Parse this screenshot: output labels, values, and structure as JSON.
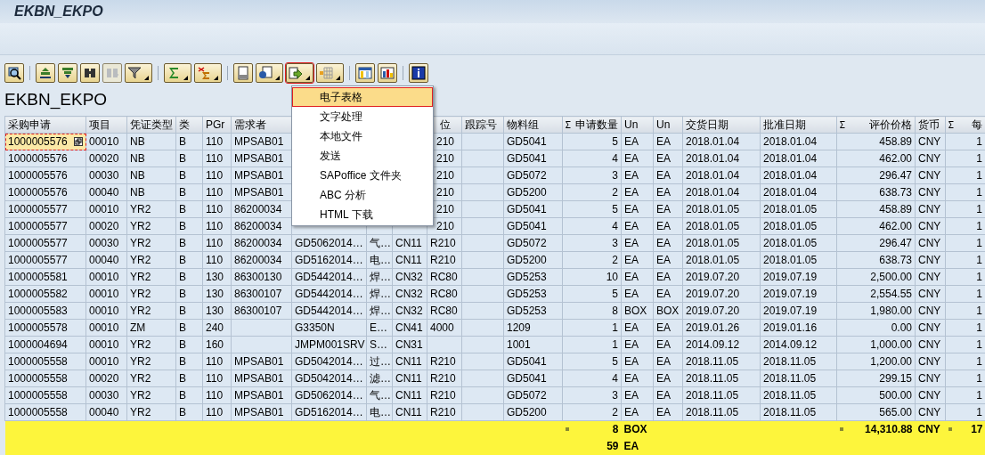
{
  "window": {
    "title": "EKBN_EKPO"
  },
  "toolbar": [
    {
      "dropdown": false,
      "disabled": false,
      "selected": false
    },
    {
      "dropdown": false,
      "disabled": false,
      "selected": false
    },
    {
      "dropdown": false,
      "disabled": false,
      "selected": false
    },
    {
      "dropdown": false,
      "disabled": false,
      "selected": false
    },
    {
      "dropdown": false,
      "disabled": true,
      "selected": false
    },
    {
      "dropdown": true,
      "disabled": false,
      "selected": false
    },
    {
      "dropdown": true,
      "disabled": false,
      "selected": false
    },
    {
      "dropdown": true,
      "disabled": false,
      "selected": false
    },
    {
      "dropdown": false,
      "disabled": false,
      "selected": false
    },
    {
      "dropdown": true,
      "disabled": false,
      "selected": false
    },
    {
      "dropdown": true,
      "disabled": false,
      "selected": true
    },
    {
      "dropdown": true,
      "disabled": false,
      "selected": false
    },
    {
      "dropdown": false,
      "disabled": false,
      "selected": false
    },
    {
      "dropdown": false,
      "disabled": false,
      "selected": false
    },
    {
      "dropdown": false,
      "disabled": false,
      "selected": false
    }
  ],
  "list_title": "EKBN_EKPO",
  "export_menu": [
    {
      "label": "电子表格",
      "selected": true
    },
    {
      "label": "文字处理",
      "selected": false
    },
    {
      "label": "本地文件",
      "selected": false
    },
    {
      "label": "发送",
      "selected": false
    },
    {
      "label": "SAPoffice 文件夹",
      "selected": false
    },
    {
      "label": "ABC 分析",
      "selected": false
    },
    {
      "label": "HTML 下载",
      "selected": false
    }
  ],
  "table": {
    "columns": [
      {
        "label": "采购申请",
        "sum": false
      },
      {
        "label": "项目",
        "sum": false
      },
      {
        "label": "凭证类型",
        "sum": false
      },
      {
        "label": "类",
        "sum": false
      },
      {
        "label": "PGr",
        "sum": false
      },
      {
        "label": "需求者",
        "sum": false
      },
      {},
      {},
      {},
      {
        "label": "位",
        "sum": false
      },
      {
        "label": "跟踪号",
        "sum": false
      },
      {
        "label": "物料组",
        "sum": false
      },
      {
        "label": "申请数量",
        "sum": true
      },
      {
        "label": "Un",
        "sum": false
      },
      {
        "label": "Un",
        "sum": false
      },
      {
        "label": "交货日期",
        "sum": false
      },
      {
        "label": "批准日期",
        "sum": false
      },
      {
        "label": "评价价格",
        "sum": true
      },
      {
        "label": "货币",
        "sum": false
      },
      {
        "label": "每",
        "sum": true
      }
    ],
    "rows": [
      {
        "focused": true,
        "cells": [
          "1000005576",
          "00010",
          "NB",
          "B",
          "110",
          "MPSAB01",
          null,
          null,
          null,
          "210",
          null,
          "GD5041",
          "5",
          "EA",
          "EA",
          "2018.01.04",
          "2018.01.04",
          "458.89",
          "CNY",
          "1"
        ]
      },
      {
        "focused": false,
        "cells": [
          "1000005576",
          "00020",
          "NB",
          "B",
          "110",
          "MPSAB01",
          null,
          null,
          null,
          "210",
          null,
          "GD5041",
          "4",
          "EA",
          "EA",
          "2018.01.04",
          "2018.01.04",
          "462.00",
          "CNY",
          "1"
        ]
      },
      {
        "focused": false,
        "cells": [
          "1000005576",
          "00030",
          "NB",
          "B",
          "110",
          "MPSAB01",
          null,
          null,
          null,
          "210",
          null,
          "GD5072",
          "3",
          "EA",
          "EA",
          "2018.01.04",
          "2018.01.04",
          "296.47",
          "CNY",
          "1"
        ]
      },
      {
        "focused": false,
        "cells": [
          "1000005576",
          "00040",
          "NB",
          "B",
          "110",
          "MPSAB01",
          null,
          null,
          null,
          "210",
          null,
          "GD5200",
          "2",
          "EA",
          "EA",
          "2018.01.04",
          "2018.01.04",
          "638.73",
          "CNY",
          "1"
        ]
      },
      {
        "focused": false,
        "cells": [
          "1000005577",
          "00010",
          "YR2",
          "B",
          "110",
          "86200034",
          null,
          null,
          null,
          "210",
          null,
          "GD5041",
          "5",
          "EA",
          "EA",
          "2018.01.05",
          "2018.01.05",
          "458.89",
          "CNY",
          "1"
        ]
      },
      {
        "focused": false,
        "cells": [
          "1000005577",
          "00020",
          "YR2",
          "B",
          "110",
          "86200034",
          null,
          null,
          null,
          "210",
          null,
          "GD5041",
          "4",
          "EA",
          "EA",
          "2018.01.05",
          "2018.01.05",
          "462.00",
          "CNY",
          "1"
        ]
      },
      {
        "focused": false,
        "cells": [
          "1000005577",
          "00030",
          "YR2",
          "B",
          "110",
          "86200034",
          "GD5062014…",
          "气…",
          "CN11",
          "R210",
          null,
          "GD5072",
          "3",
          "EA",
          "EA",
          "2018.01.05",
          "2018.01.05",
          "296.47",
          "CNY",
          "1"
        ]
      },
      {
        "focused": false,
        "cells": [
          "1000005577",
          "00040",
          "YR2",
          "B",
          "110",
          "86200034",
          "GD5162014…",
          "电…",
          "CN11",
          "R210",
          null,
          "GD5200",
          "2",
          "EA",
          "EA",
          "2018.01.05",
          "2018.01.05",
          "638.73",
          "CNY",
          "1"
        ]
      },
      {
        "focused": false,
        "cells": [
          "1000005581",
          "00010",
          "YR2",
          "B",
          "130",
          "86300130",
          "GD5442014…",
          "焊…",
          "CN32",
          "RC80",
          null,
          "GD5253",
          "10",
          "EA",
          "EA",
          "2019.07.20",
          "2019.07.19",
          "2,500.00",
          "CNY",
          "1"
        ]
      },
      {
        "focused": false,
        "cells": [
          "1000005582",
          "00010",
          "YR2",
          "B",
          "130",
          "86300107",
          "GD5442014…",
          "焊…",
          "CN32",
          "RC80",
          null,
          "GD5253",
          "5",
          "EA",
          "EA",
          "2019.07.20",
          "2019.07.19",
          "2,554.55",
          "CNY",
          "1"
        ]
      },
      {
        "focused": false,
        "cells": [
          "1000005583",
          "00010",
          "YR2",
          "B",
          "130",
          "86300107",
          "GD5442014…",
          "焊…",
          "CN32",
          "RC80",
          null,
          "GD5253",
          "8",
          "BOX",
          "BOX",
          "2019.07.20",
          "2019.07.19",
          "1,980.00",
          "CNY",
          "1"
        ]
      },
      {
        "focused": false,
        "cells": [
          "1000005578",
          "00010",
          "ZM",
          "B",
          "240",
          null,
          "G3350N",
          "E…",
          "CN41",
          "4000",
          null,
          "1209",
          "1",
          "EA",
          "EA",
          "2019.01.26",
          "2019.01.16",
          "0.00",
          "CNY",
          "1"
        ]
      },
      {
        "focused": false,
        "cells": [
          "1000004694",
          "00010",
          "YR2",
          "B",
          "160",
          null,
          "JMPM001SRV",
          "S…",
          "CN31",
          null,
          null,
          "1001",
          "1",
          "EA",
          "EA",
          "2014.09.12",
          "2014.09.12",
          "1,000.00",
          "CNY",
          "1"
        ]
      },
      {
        "focused": false,
        "cells": [
          "1000005558",
          "00010",
          "YR2",
          "B",
          "110",
          "MPSAB01",
          "GD5042014…",
          "过…",
          "CN11",
          "R210",
          null,
          "GD5041",
          "5",
          "EA",
          "EA",
          "2018.11.05",
          "2018.11.05",
          "1,200.00",
          "CNY",
          "1"
        ]
      },
      {
        "focused": false,
        "cells": [
          "1000005558",
          "00020",
          "YR2",
          "B",
          "110",
          "MPSAB01",
          "GD5042014…",
          "滤…",
          "CN11",
          "R210",
          null,
          "GD5041",
          "4",
          "EA",
          "EA",
          "2018.11.05",
          "2018.11.05",
          "299.15",
          "CNY",
          "1"
        ]
      },
      {
        "focused": false,
        "cells": [
          "1000005558",
          "00030",
          "YR2",
          "B",
          "110",
          "MPSAB01",
          "GD5062014…",
          "气…",
          "CN11",
          "R210",
          null,
          "GD5072",
          "3",
          "EA",
          "EA",
          "2018.11.05",
          "2018.11.05",
          "500.00",
          "CNY",
          "1"
        ]
      },
      {
        "focused": false,
        "cells": [
          "1000005558",
          "00040",
          "YR2",
          "B",
          "110",
          "MPSAB01",
          "GD5162014…",
          "电…",
          "CN11",
          "R210",
          null,
          "GD5200",
          "2",
          "EA",
          "EA",
          "2018.11.05",
          "2018.11.05",
          "565.00",
          "CNY",
          "1"
        ]
      }
    ],
    "totals": [
      {
        "marker": true,
        "quantity": "8",
        "unit": "BOX",
        "value": "14,310.88",
        "currency": "CNY",
        "per": "17"
      },
      {
        "marker": false,
        "quantity": "59",
        "unit": "EA"
      }
    ]
  }
}
